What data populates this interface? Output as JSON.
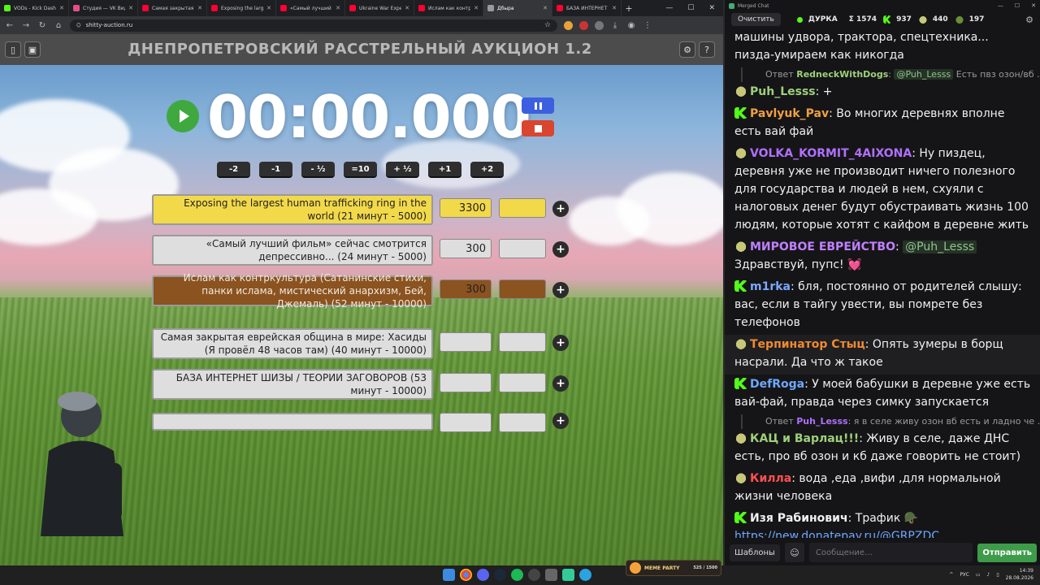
{
  "browser": {
    "tabs": [
      {
        "label": "VODs - Kick Dashb",
        "color": "#53fc18"
      },
      {
        "label": "Студия — VK Виде",
        "color": "#e54d8a"
      },
      {
        "label": "Самая закрытая е",
        "color": "#ff0033"
      },
      {
        "label": "Exposing the larg",
        "color": "#ff0033"
      },
      {
        "label": "«Самый лучший ф",
        "color": "#ff0033"
      },
      {
        "label": "Ukraine War Expe",
        "color": "#ff0033"
      },
      {
        "label": "Ислам как контрк",
        "color": "#ff0033"
      },
      {
        "label": "Дбыра",
        "color": "#9a9a9a"
      },
      {
        "label": "БАЗА ИНТЕРНЕТ",
        "color": "#ff0033"
      }
    ],
    "url": "shitty-auction.ru"
  },
  "app": {
    "title": "ДНЕПРОПЕТРОВСКИЙ РАССТРЕЛЬНЫЙ АУКЦИОН 1.2",
    "timer": "00:00.000",
    "adjust_buttons": [
      "-2",
      "-1",
      "- ½",
      "=10",
      "+ ½",
      "+1",
      "+2"
    ],
    "lots": [
      {
        "name": "Exposing the largest human trafficking ring in the world (21 минут - 5000)",
        "amount": "3300",
        "color": "yellow"
      },
      {
        "name": "«Самый лучший фильм» сейчас смотрится депрессивно... (24 минут - 5000)",
        "amount": "300",
        "color": "gray"
      },
      {
        "name": "Ислам как контркультура (Сатанинские стихи, панки ислама, мистический анархизм,  Бей, Джемаль) (52 минут - 10000)",
        "amount": "300",
        "color": "brown"
      },
      {
        "name": "Самая закрытая еврейская община в мире: Хасиды (Я провёл 48 часов там) (40 минут - 10000)",
        "amount": "",
        "color": "gray"
      },
      {
        "name": "БАЗА ИНТЕРНЕТ ШИЗЫ / ТЕОРИИ ЗАГОВОРОВ (53 минут - 10000)",
        "amount": "",
        "color": "gray"
      },
      {
        "name": "",
        "amount": "",
        "color": "gray"
      }
    ]
  },
  "chat": {
    "window_title": "Merged Chat",
    "clear_label": "Очистить",
    "stats": {
      "name": "ДУРКА",
      "total": "Σ 1574",
      "kick": "937",
      "pepe": "440",
      "other": "197"
    },
    "messages": [
      {
        "kind": "msg",
        "user": "",
        "color": "#f0f0f0",
        "badge": "",
        "text": "машины удвора, трактора, спецтехника... пизда-умираем как никогда"
      },
      {
        "kind": "reply",
        "prefix": "Ответ",
        "user": "RedneckWithDogs",
        "color": "#9fd07a",
        "mention": "@Puh_Lesss",
        "text": "Есть пвз озон/вб ..."
      },
      {
        "kind": "msg",
        "user": "Puh_Lesss",
        "color": "#9fd07a",
        "badge": "pepe2",
        "text": "+"
      },
      {
        "kind": "msg",
        "user": "Pavlyuk_Pav",
        "color": "#f0a040",
        "badge": "kick",
        "text": "Во многих деревнях вполне есть вай фай"
      },
      {
        "kind": "msg",
        "user": "VOLKA_KORMIT_4AIXONA",
        "color": "#b070ff",
        "badge": "pepe2",
        "text": "Ну пиздец, деревня уже не производит ничего полезного для государства и людей в нем, схуяли с налоговых денег будут обустраивать жизнь 100 людям, которые хотят с кайфом в деревне жить"
      },
      {
        "kind": "msg",
        "user": "МИРОВОЕ ЕВРЕЙСТВО",
        "color": "#c080ff",
        "badge": "pepe2",
        "mention": "@Puh_Lesss",
        "text": "Здравствуй, пупс! 💓"
      },
      {
        "kind": "msg",
        "user": "m1rka",
        "color": "#7aa8ff",
        "badge": "kick",
        "text": "бля, постоянно от родителей слышу: вас, если в тайгу увести, вы помрете без телефонов"
      },
      {
        "kind": "msg",
        "user": "Терпинатор Стыц",
        "color": "#f08a30",
        "badge": "pepe2",
        "text": "Опять зумеры в борщ насрали. Да что ж такое",
        "hl": true
      },
      {
        "kind": "msg",
        "user": "DefRoga",
        "color": "#6fa8ff",
        "badge": "kick",
        "text": "У моей бабушки в деревне уже есть вай-фай, правда через симку запускается"
      },
      {
        "kind": "reply",
        "prefix": "Ответ",
        "user": "Puh_Lesss",
        "color": "#b070ff",
        "mention": "",
        "text": "я в селе живу озон вб есть и ладно че ..."
      },
      {
        "kind": "msg",
        "user": "КАЦ и Варлац!!!",
        "color": "#9fd07a",
        "badge": "pepe2",
        "text": "Живу в селе, даже ДНС есть, про вб озон и кб даже говорить не стоит)"
      },
      {
        "kind": "msg",
        "user": "Килла",
        "color": "#ff5050",
        "badge": "pepe2",
        "text": "вода ,еда ,вифи ,для нормальной жизни человека"
      },
      {
        "kind": "msg",
        "user": "Изя Рабинович",
        "color": "#f0f0f0",
        "badge": "kick",
        "text": "Трафик 🪖",
        "link": "https://new.donatepay.ru/@GRPZDC"
      }
    ],
    "templates_label": "Шаблоны",
    "input_placeholder": "Сообщение...",
    "send_label": "Отправить"
  },
  "taskbar": {
    "party_label": "MEME PARTY",
    "party_count": "525 / 1500",
    "lang": "РУС",
    "time": "14:39",
    "date": "28.08.2026"
  },
  "colors": {
    "accent_green": "#3e9b4a",
    "play": "#3fa83f",
    "pause": "#3c5fe0",
    "stop": "#d9452f",
    "lot_yellow": "#f2d94a",
    "lot_brown": "#8a5320"
  }
}
